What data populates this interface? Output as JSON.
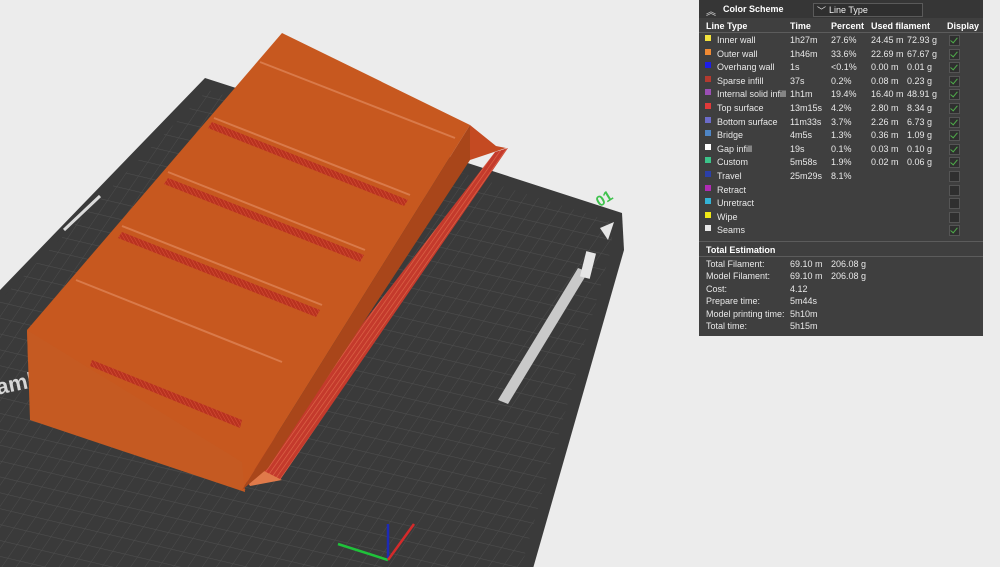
{
  "panel": {
    "title": "Color Scheme",
    "scheme_select": "Line Type",
    "headers": {
      "line_type": "Line Type",
      "time": "Time",
      "percent": "Percent",
      "used": "Used filament",
      "display": "Display"
    },
    "rows": [
      {
        "name": "Inner wall",
        "time": "1h27m",
        "percent": "27.6%",
        "len": "24.45 m",
        "wt": "72.93 g",
        "color": "#f2e23c",
        "shown": true
      },
      {
        "name": "Outer wall",
        "time": "1h46m",
        "percent": "33.6%",
        "len": "22.69 m",
        "wt": "67.67 g",
        "color": "#f08a33",
        "shown": true
      },
      {
        "name": "Overhang wall",
        "time": "1s",
        "percent": "<0.1%",
        "len": "0.00 m",
        "wt": "0.01 g",
        "color": "#1d1de8",
        "shown": true
      },
      {
        "name": "Sparse infill",
        "time": "37s",
        "percent": "0.2%",
        "len": "0.08 m",
        "wt": "0.23 g",
        "color": "#b33a2f",
        "shown": true
      },
      {
        "name": "Internal solid infill",
        "time": "1h1m",
        "percent": "19.4%",
        "len": "16.40 m",
        "wt": "48.91 g",
        "color": "#9b4fb5",
        "shown": true
      },
      {
        "name": "Top surface",
        "time": "13m15s",
        "percent": "4.2%",
        "len": "2.80 m",
        "wt": "8.34 g",
        "color": "#e03a3a",
        "shown": true
      },
      {
        "name": "Bottom surface",
        "time": "11m33s",
        "percent": "3.7%",
        "len": "2.26 m",
        "wt": "6.73 g",
        "color": "#6b6bc9",
        "shown": true
      },
      {
        "name": "Bridge",
        "time": "4m5s",
        "percent": "1.3%",
        "len": "0.36 m",
        "wt": "1.09 g",
        "color": "#4f86c6",
        "shown": true
      },
      {
        "name": "Gap infill",
        "time": "19s",
        "percent": "0.1%",
        "len": "0.03 m",
        "wt": "0.10 g",
        "color": "#ffffff",
        "shown": true
      },
      {
        "name": "Custom",
        "time": "5m58s",
        "percent": "1.9%",
        "len": "0.02 m",
        "wt": "0.06 g",
        "color": "#3cc48a",
        "shown": true
      },
      {
        "name": "Travel",
        "time": "25m29s",
        "percent": "8.1%",
        "len": "",
        "wt": "",
        "color": "#2b3fa8",
        "shown": false
      },
      {
        "name": "Retract",
        "time": "",
        "percent": "",
        "len": "",
        "wt": "",
        "color": "#b02bb3",
        "shown": false
      },
      {
        "name": "Unretract",
        "time": "",
        "percent": "",
        "len": "",
        "wt": "",
        "color": "#34b3d6",
        "shown": false
      },
      {
        "name": "Wipe",
        "time": "",
        "percent": "",
        "len": "",
        "wt": "",
        "color": "#f0e817",
        "shown": false
      },
      {
        "name": "Seams",
        "time": "",
        "percent": "",
        "len": "",
        "wt": "",
        "color": "#e8e8e8",
        "shown": true
      }
    ],
    "total_title": "Total Estimation",
    "totals": [
      {
        "label": "Total Filament:",
        "v1": "69.10 m",
        "v2": "206.08 g"
      },
      {
        "label": "Model Filament:",
        "v1": "69.10 m",
        "v2": "206.08 g"
      },
      {
        "label": "Cost:",
        "v1": "4.12",
        "v2": ""
      },
      {
        "label": "Prepare time:",
        "v1": "5m44s",
        "v2": ""
      },
      {
        "label": "Model printing time:",
        "v1": "5h10m",
        "v2": ""
      },
      {
        "label": "Total time:",
        "v1": "5h15m",
        "v2": ""
      }
    ]
  },
  "scene": {
    "plate_number": "01",
    "bed_brand_partial": "ambu",
    "model_color": "#c7581f"
  }
}
